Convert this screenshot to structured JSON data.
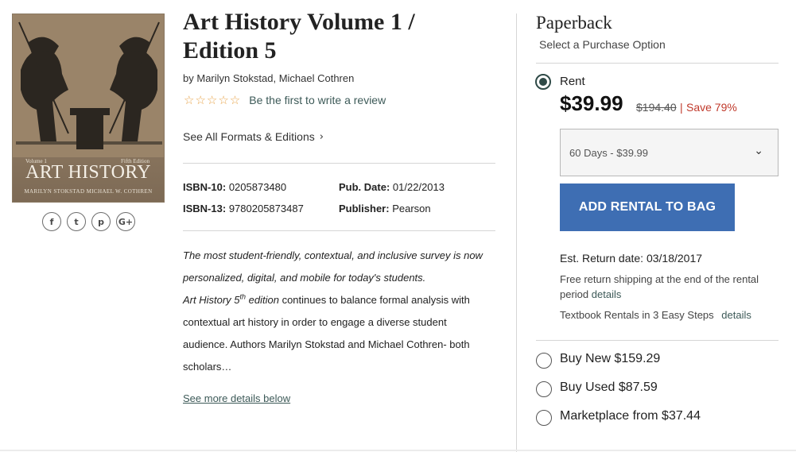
{
  "cover": {
    "volume": "Volume 1",
    "edition": "Fifth Edition",
    "title": "ART HISTORY",
    "authors": "MARILYN STOKSTAD     MICHAEL W. COTHREN"
  },
  "social": [
    "f",
    "t",
    "p",
    "G+"
  ],
  "book": {
    "title": "Art History Volume 1 / Edition 5",
    "by_label": "by",
    "author1": "Marilyn Stokstad",
    "author2": "Michael Cothren",
    "stars": "☆☆☆☆☆",
    "review_link": "Be the first to write a review",
    "formats_link": "See All Formats & Editions"
  },
  "meta": {
    "isbn10_label": "ISBN-10:",
    "isbn10": "0205873480",
    "isbn13_label": "ISBN-13:",
    "isbn13": "9780205873487",
    "pubdate_label": "Pub. Date:",
    "pubdate": "01/22/2013",
    "publisher_label": "Publisher:",
    "publisher": "Pearson"
  },
  "description": {
    "line1": "The most student-friendly, contextual, and inclusive survey is now",
    "line2": "personalized, digital, and mobile for today's students.",
    "line3_italic": "Art History 5",
    "line3_sup": "th",
    "line3_italic2": " edition",
    "line3_rest": " continues to balance formal analysis with",
    "line4": "contextual art history in order to engage a diverse student",
    "line5": "audience. Authors Marilyn Stokstad and Michael Cothren- both",
    "line6": "scholars…",
    "see_more": "See more details below"
  },
  "purchase": {
    "format": "Paperback",
    "select_label": "Select a Purchase Option",
    "rent_label": "Rent",
    "rent_price": "$39.99",
    "list_price": "$194.40",
    "separator": "|",
    "save": "Save 79%",
    "rental_period": "60 Days - $39.99",
    "add_button": "ADD RENTAL TO BAG",
    "return_date": "Est. Return date: 03/18/2017",
    "shipping_line1": "Free return shipping at the end of the rental",
    "shipping_line2": "period",
    "shipping_details": "details",
    "steps_text": "Textbook Rentals in 3 Easy Steps",
    "steps_details": "details",
    "buy_new": "Buy New $159.29",
    "buy_used": "Buy Used $87.59",
    "marketplace": "Marketplace from $37.44"
  }
}
